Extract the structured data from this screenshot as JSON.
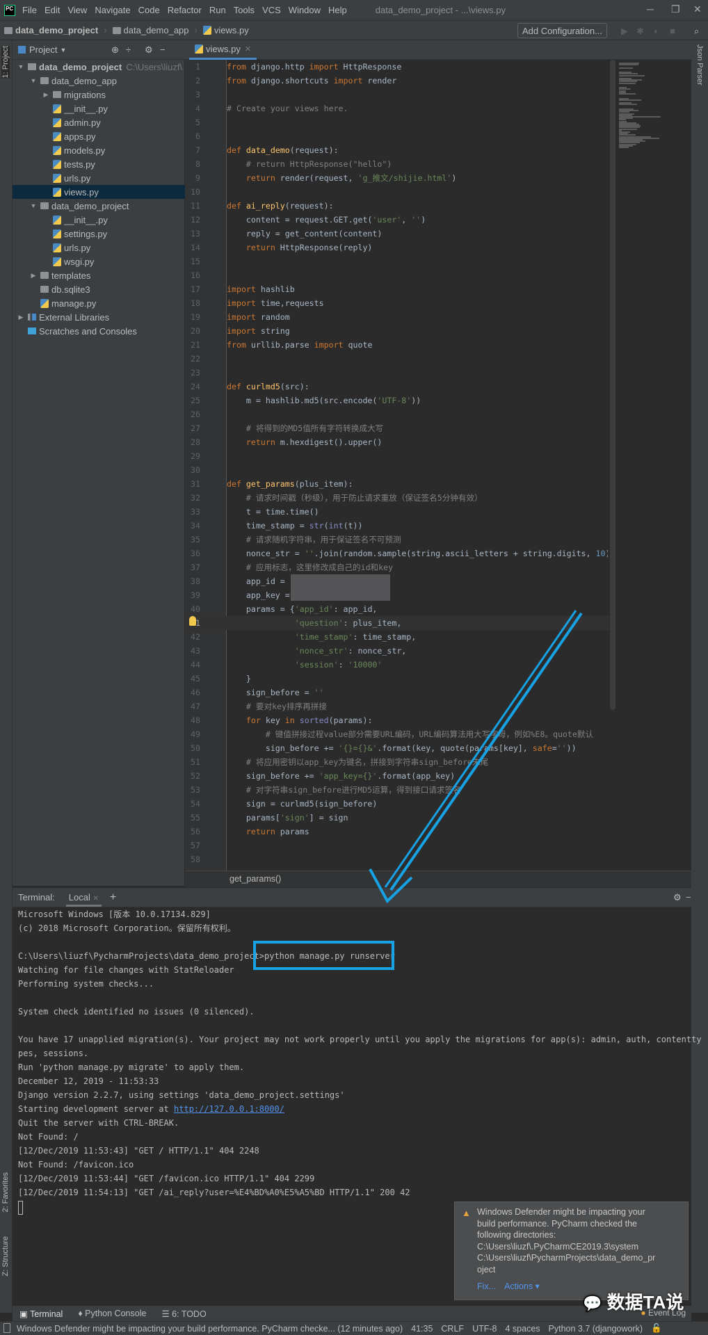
{
  "menubar": {
    "logo": "PC",
    "items": [
      "File",
      "Edit",
      "View",
      "Navigate",
      "Code",
      "Refactor",
      "Run",
      "Tools",
      "VCS",
      "Window",
      "Help"
    ],
    "title": "data_demo_project - ...\\views.py"
  },
  "navbar": {
    "crumbs": [
      "data_demo_project",
      "data_demo_app",
      "views.py"
    ],
    "add_configuration": "Add Configuration..."
  },
  "left_stripe": {
    "project": "1: Project",
    "favorites": "2: Favorites",
    "structure": "Z: Structure"
  },
  "right_stripe": {
    "json_parser": "Json Parser"
  },
  "project_panel": {
    "title": "Project",
    "tree": [
      {
        "label": "data_demo_project",
        "level": 0,
        "type": "folder",
        "expanded": true,
        "bold": true,
        "path": "C:\\Users\\liuzf\\"
      },
      {
        "label": "data_demo_app",
        "level": 1,
        "type": "folder",
        "expanded": true
      },
      {
        "label": "migrations",
        "level": 2,
        "type": "folder",
        "expanded": false
      },
      {
        "label": "__init__.py",
        "level": 2,
        "type": "py"
      },
      {
        "label": "admin.py",
        "level": 2,
        "type": "py"
      },
      {
        "label": "apps.py",
        "level": 2,
        "type": "py"
      },
      {
        "label": "models.py",
        "level": 2,
        "type": "py"
      },
      {
        "label": "tests.py",
        "level": 2,
        "type": "py"
      },
      {
        "label": "urls.py",
        "level": 2,
        "type": "py"
      },
      {
        "label": "views.py",
        "level": 2,
        "type": "py",
        "selected": true
      },
      {
        "label": "data_demo_project",
        "level": 1,
        "type": "folder",
        "expanded": true
      },
      {
        "label": "__init__.py",
        "level": 2,
        "type": "py"
      },
      {
        "label": "settings.py",
        "level": 2,
        "type": "py"
      },
      {
        "label": "urls.py",
        "level": 2,
        "type": "py"
      },
      {
        "label": "wsgi.py",
        "level": 2,
        "type": "py"
      },
      {
        "label": "templates",
        "level": 1,
        "type": "folder",
        "expanded": false
      },
      {
        "label": "db.sqlite3",
        "level": 1,
        "type": "db"
      },
      {
        "label": "manage.py",
        "level": 1,
        "type": "py"
      },
      {
        "label": "External Libraries",
        "level": 0,
        "type": "lib",
        "expanded": false
      },
      {
        "label": "Scratches and Consoles",
        "level": 0,
        "type": "scratch"
      }
    ]
  },
  "editor": {
    "tab": "views.py",
    "current_line": 41,
    "sticky": "get_params()",
    "lines": [
      [
        [
          "k",
          "from"
        ],
        [
          "",
          " django.http "
        ],
        [
          "k",
          "import"
        ],
        [
          "",
          " HttpResponse"
        ]
      ],
      [
        [
          "k",
          "from"
        ],
        [
          "",
          " django.shortcuts "
        ],
        [
          "k",
          "import"
        ],
        [
          "",
          " render"
        ]
      ],
      [],
      [
        [
          "c",
          "# Create your views here."
        ]
      ],
      [],
      [],
      [
        [
          "k",
          "def "
        ],
        [
          "f",
          "data_demo"
        ],
        [
          "",
          "(request):"
        ]
      ],
      [
        [
          "",
          "    "
        ],
        [
          "c",
          "# return HttpResponse(\"hello\")"
        ]
      ],
      [
        [
          "",
          "    "
        ],
        [
          "k",
          "return"
        ],
        [
          "",
          " render(request, "
        ],
        [
          "s",
          "'g_推文/shijie.html'"
        ],
        [
          "",
          ")"
        ]
      ],
      [],
      [
        [
          "k",
          "def "
        ],
        [
          "f",
          "ai_reply"
        ],
        [
          "",
          "(request):"
        ]
      ],
      [
        [
          "",
          "    content = request.GET.get("
        ],
        [
          "s",
          "'user'"
        ],
        [
          "",
          ", "
        ],
        [
          "s",
          "''"
        ],
        [
          "",
          ")"
        ]
      ],
      [
        [
          "",
          "    reply = get_content(content)"
        ]
      ],
      [
        [
          "",
          "    "
        ],
        [
          "k",
          "return"
        ],
        [
          "",
          " HttpResponse(reply)"
        ]
      ],
      [],
      [],
      [
        [
          "k",
          "import"
        ],
        [
          "",
          " hashlib"
        ]
      ],
      [
        [
          "k",
          "import"
        ],
        [
          "",
          " time,requests"
        ]
      ],
      [
        [
          "k",
          "import"
        ],
        [
          "",
          " random"
        ]
      ],
      [
        [
          "k",
          "import"
        ],
        [
          "",
          " string"
        ]
      ],
      [
        [
          "k",
          "from"
        ],
        [
          "",
          " urllib.parse "
        ],
        [
          "k",
          "import"
        ],
        [
          "",
          " quote"
        ]
      ],
      [],
      [],
      [
        [
          "k",
          "def "
        ],
        [
          "f",
          "curlmd5"
        ],
        [
          "",
          "(src):"
        ]
      ],
      [
        [
          "",
          "    m = hashlib.md5(src.encode("
        ],
        [
          "s",
          "'UTF-8'"
        ],
        [
          "",
          "))"
        ]
      ],
      [],
      [
        [
          "",
          "    "
        ],
        [
          "c",
          "# 将得到的MD5值所有字符转换成大写"
        ]
      ],
      [
        [
          "",
          "    "
        ],
        [
          "k",
          "return"
        ],
        [
          "",
          " m.hexdigest().upper()"
        ]
      ],
      [],
      [],
      [
        [
          "k",
          "def "
        ],
        [
          "f",
          "get_params"
        ],
        [
          "",
          "(plus_item):"
        ]
      ],
      [
        [
          "",
          "    "
        ],
        [
          "c",
          "# 请求时间戳（秒级），用于防止请求重放（保证签名5分钟有效）"
        ]
      ],
      [
        [
          "",
          "    t = time.time()"
        ]
      ],
      [
        [
          "",
          "    time_stamp = "
        ],
        [
          "b",
          "str"
        ],
        [
          "",
          "("
        ],
        [
          "b",
          "int"
        ],
        [
          "",
          "(t))"
        ]
      ],
      [
        [
          "",
          "    "
        ],
        [
          "c",
          "# 请求随机字符串，用于保证签名不可预测"
        ]
      ],
      [
        [
          "",
          "    nonce_str = "
        ],
        [
          "s",
          "''"
        ],
        [
          "",
          ".join(random.sample(string.ascii_letters + string.digits, "
        ],
        [
          "n",
          "10"
        ],
        [
          "",
          "))"
        ]
      ],
      [
        [
          "",
          "    "
        ],
        [
          "c",
          "# 应用标志，这里修改成自己的id和key"
        ]
      ],
      [
        [
          "",
          "    app_id = "
        ]
      ],
      [
        [
          "",
          "    app_key = "
        ]
      ],
      [
        [
          "",
          "    params = {"
        ],
        [
          "s",
          "'app_id'"
        ],
        [
          "",
          ": app_id,"
        ]
      ],
      [
        [
          "",
          "              "
        ],
        [
          "s",
          "'question'"
        ],
        [
          "",
          ": plus_item,"
        ]
      ],
      [
        [
          "",
          "              "
        ],
        [
          "s",
          "'time_stamp'"
        ],
        [
          "",
          ": time_stamp,"
        ]
      ],
      [
        [
          "",
          "              "
        ],
        [
          "s",
          "'nonce_str'"
        ],
        [
          "",
          ": nonce_str,"
        ]
      ],
      [
        [
          "",
          "              "
        ],
        [
          "s",
          "'session'"
        ],
        [
          "",
          ": "
        ],
        [
          "s",
          "'10000'"
        ]
      ],
      [
        [
          "",
          "    }"
        ]
      ],
      [
        [
          "",
          "    sign_before = "
        ],
        [
          "s",
          "''"
        ]
      ],
      [
        [
          "",
          "    "
        ],
        [
          "c",
          "# 要对key排序再拼接"
        ]
      ],
      [
        [
          "",
          "    "
        ],
        [
          "k",
          "for"
        ],
        [
          "",
          " key "
        ],
        [
          "k",
          "in"
        ],
        [
          "",
          " "
        ],
        [
          "b",
          "sorted"
        ],
        [
          "",
          "(params):"
        ]
      ],
      [
        [
          "",
          "        "
        ],
        [
          "c",
          "# 键值拼接过程value部分需要URL编码，URL编码算法用大写字母，例如%E8。quote默认"
        ]
      ],
      [
        [
          "",
          "        sign_before += "
        ],
        [
          "s",
          "'{}={}&'"
        ],
        [
          "",
          ".format(key, quote(params[key], "
        ],
        [
          "k",
          "safe"
        ],
        [
          "",
          "="
        ],
        [
          "s",
          "''"
        ],
        [
          "",
          "))"
        ]
      ],
      [
        [
          "",
          "    "
        ],
        [
          "c",
          "# 将应用密钥以app_key为键名，拼接到字符串sign_before末尾"
        ]
      ],
      [
        [
          "",
          "    sign_before += "
        ],
        [
          "s",
          "'app_key={}'"
        ],
        [
          "",
          ".format(app_key)"
        ]
      ],
      [
        [
          "",
          "    "
        ],
        [
          "c",
          "# 对字符串sign_before进行MD5运算，得到接口请求签名"
        ]
      ],
      [
        [
          "",
          "    sign = curlmd5(sign_before)"
        ]
      ],
      [
        [
          "",
          "    params["
        ],
        [
          "s",
          "'sign'"
        ],
        [
          "",
          "] = sign"
        ]
      ],
      [
        [
          "",
          "    "
        ],
        [
          "k",
          "return"
        ],
        [
          "",
          " params"
        ]
      ],
      [],
      []
    ]
  },
  "terminal": {
    "label": "Terminal:",
    "tab": "Local",
    "lines": [
      [
        [
          "",
          "Microsoft Windows [版本 10.0.17134.829]"
        ]
      ],
      [
        [
          "",
          "(c) 2018 Microsoft Corporation。保留所有权利。"
        ]
      ],
      [],
      [
        [
          "",
          "C:\\Users\\liuzf\\PycharmProjects\\data_demo_project>python manage.py runserver"
        ]
      ],
      [
        [
          "",
          "Watching for file changes with StatReloader"
        ]
      ],
      [
        [
          "",
          "Performing system checks..."
        ]
      ],
      [],
      [
        [
          "",
          "System check identified no issues (0 silenced)."
        ]
      ],
      [],
      [
        [
          "",
          "You have 17 unapplied migration(s). Your project may not work properly until you apply the migrations for app(s): admin, auth, contentty"
        ]
      ],
      [
        [
          "",
          "pes, sessions."
        ]
      ],
      [
        [
          "",
          "Run 'python manage.py migrate' to apply them."
        ]
      ],
      [
        [
          "",
          "December 12, 2019 - 11:53:33"
        ]
      ],
      [
        [
          "",
          "Django version 2.2.7, using settings 'data_demo_project.settings'"
        ]
      ],
      [
        [
          "",
          "Starting development server at "
        ],
        [
          "link",
          "http://127.0.0.1:8000/"
        ]
      ],
      [
        [
          "",
          "Quit the server with CTRL-BREAK."
        ]
      ],
      [
        [
          "",
          "Not Found: /"
        ]
      ],
      [
        [
          "",
          "[12/Dec/2019 11:53:43] \"GET / HTTP/1.1\" 404 2248"
        ]
      ],
      [
        [
          "",
          "Not Found: /favicon.ico"
        ]
      ],
      [
        [
          "",
          "[12/Dec/2019 11:53:44] \"GET /favicon.ico HTTP/1.1\" 404 2299"
        ]
      ],
      [
        [
          "",
          "[12/Dec/2019 11:54:13] \"GET /ai_reply?user=%E4%BD%A0%E5%A5%BD HTTP/1.1\" 200 42"
        ]
      ]
    ]
  },
  "notification": {
    "lines": [
      "Windows Defender might be impacting your",
      "build performance. PyCharm checked the",
      "following directories:",
      "C:\\Users\\liuzf\\.PyCharmCE2019.3\\system",
      "C:\\Users\\liuzf\\PycharmProjects\\data_demo_pr",
      "oject"
    ],
    "fix": "Fix...",
    "actions": "Actions ▾"
  },
  "bottom_tabs": {
    "terminal": "Terminal",
    "python_console": "Python Console",
    "todo": "6: TODO",
    "event_log": "Event Log"
  },
  "statusbar": {
    "message": "Windows Defender might be impacting your build performance. PyCharm checke... (12 minutes ago)",
    "position": "41:35",
    "line_sep": "CRLF",
    "encoding": "UTF-8",
    "indent": "4 spaces",
    "interpreter": "Python 3.7 (djangowork)"
  },
  "watermark": "数据TA说",
  "colors": {
    "accent": "#17a2e5",
    "keyword": "#cc7832",
    "string": "#6a8759",
    "comment": "#808080",
    "function": "#ffc66d"
  }
}
